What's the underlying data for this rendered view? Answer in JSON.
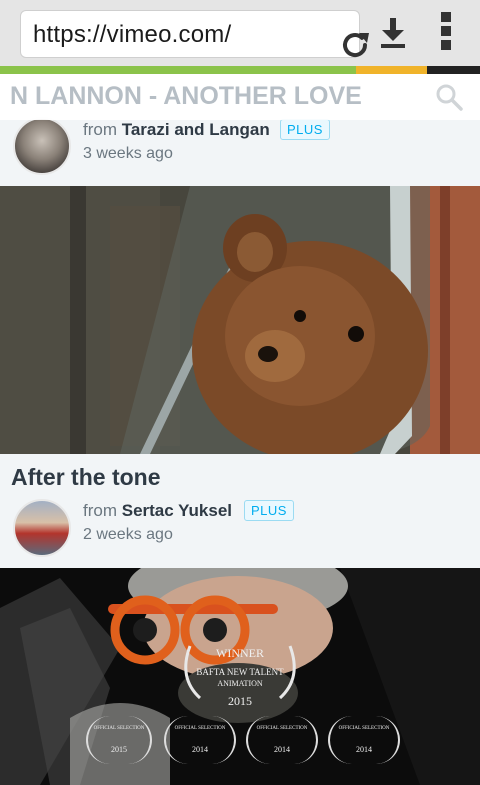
{
  "browser": {
    "url": "https://vimeo.com/"
  },
  "page_load_progress": 0.89,
  "sticky_header": {
    "title": "N  LANNON - ANOTHER LOVE"
  },
  "videos": [
    {
      "from_prefix": "from",
      "author": "Tarazi and Langan",
      "badge": "PLUS",
      "posted": "3 weeks ago"
    },
    {
      "title": "After the tone",
      "from_prefix": "from",
      "author": "Sertac Yuksel",
      "badge": "PLUS",
      "posted": "2 weeks ago",
      "thumbnail_overlay": {
        "award_line1": "WINNER",
        "award_line2": "BAFTA NEW TALENT",
        "award_line3": "ANIMATION",
        "award_year": "2015",
        "laurels": [
          {
            "label": "OFFICIAL SELECTION",
            "year": "2015"
          },
          {
            "label": "OFFICIAL SELECTION",
            "year": "2014"
          },
          {
            "label": "OFFICIAL SELECTION",
            "year": "2014"
          },
          {
            "label": "OFFICIAL SELECTION",
            "year": "2014"
          }
        ]
      }
    }
  ],
  "colors": {
    "progress_loaded": "#8bc34a",
    "progress_loading": "#f0b32a",
    "plus_badge": "#00adef"
  }
}
